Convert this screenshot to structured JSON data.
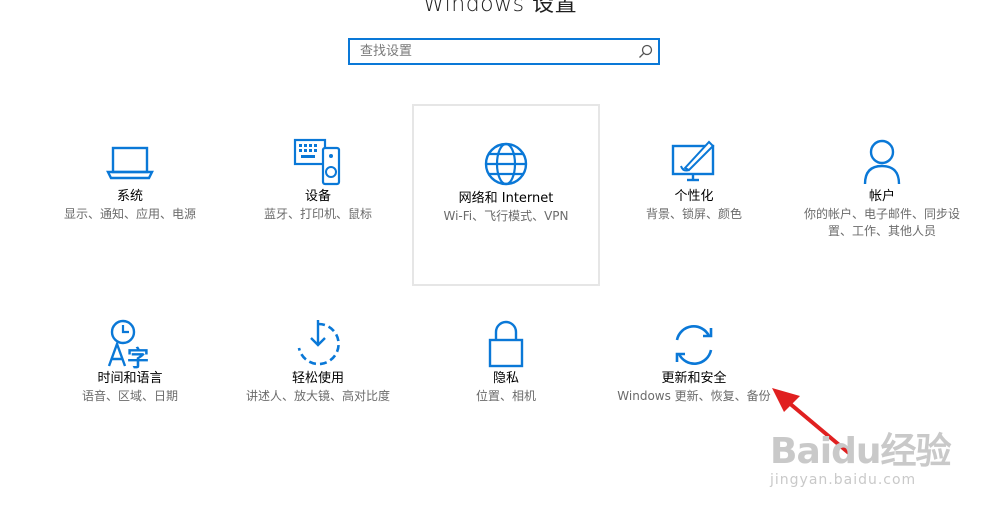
{
  "window": {
    "title": "Windows 设置"
  },
  "search": {
    "placeholder": "查找设置",
    "icon": "search-icon"
  },
  "accent_color": "#0a78d7",
  "tiles": [
    {
      "name": "系统",
      "desc": "显示、通知、应用、电源",
      "icon": "laptop-icon"
    },
    {
      "name": "设备",
      "desc": "蓝牙、打印机、鼠标",
      "icon": "devices-icon"
    },
    {
      "name": "网络和 Internet",
      "desc": "Wi-Fi、飞行模式、VPN",
      "icon": "globe-icon"
    },
    {
      "name": "个性化",
      "desc": "背景、锁屏、颜色",
      "icon": "paint-icon"
    },
    {
      "name": "帐户",
      "desc": "你的帐户、电子邮件、同步设置、工作、其他人员",
      "icon": "person-icon"
    },
    {
      "name": "时间和语言",
      "desc": "语音、区域、日期",
      "icon": "time-language-icon"
    },
    {
      "name": "轻松使用",
      "desc": "讲述人、放大镜、高对比度",
      "icon": "ease-of-access-icon"
    },
    {
      "name": "隐私",
      "desc": "位置、相机",
      "icon": "lock-icon"
    },
    {
      "name": "更新和安全",
      "desc": "Windows 更新、恢复、备份",
      "icon": "update-icon"
    }
  ],
  "annotation": {
    "arrow_color": "#e02020"
  },
  "watermark": {
    "logo": "Baidu经验",
    "url": "jingyan.baidu.com"
  }
}
